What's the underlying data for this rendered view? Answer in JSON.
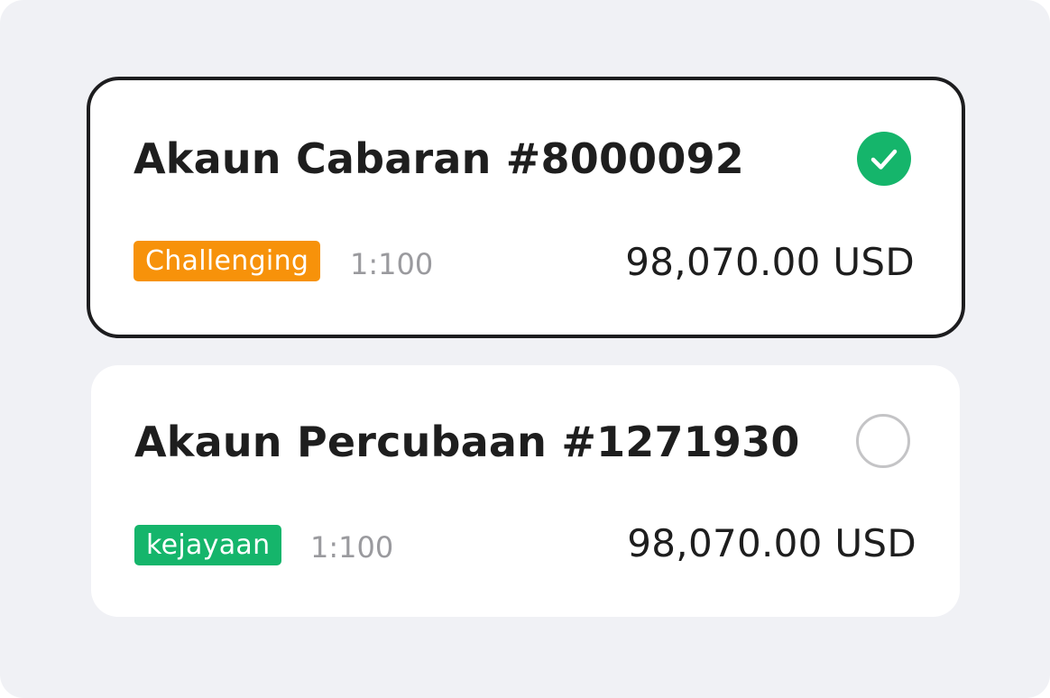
{
  "accounts": [
    {
      "title": "Akaun Cabaran #8000092",
      "badge": "Challenging",
      "badge_color": "#f7920a",
      "leverage": "1:100",
      "balance": "98,070.00 USD",
      "selected": true,
      "status_icon": "check-circle-icon"
    },
    {
      "title": "Akaun Percubaan #1271930",
      "badge": "kejayaan",
      "badge_color": "#15b56b",
      "leverage": "1:100",
      "balance": "98,070.00 USD",
      "selected": false,
      "status_icon": "radio-empty-icon"
    }
  ],
  "colors": {
    "background": "#f0f1f5",
    "card": "#ffffff",
    "selected_border": "#1d1d1f",
    "check_green": "#15b56b",
    "radio_border": "#c4c4c6",
    "title_text": "#1e1e1e",
    "muted_text": "#9a9a9e"
  }
}
